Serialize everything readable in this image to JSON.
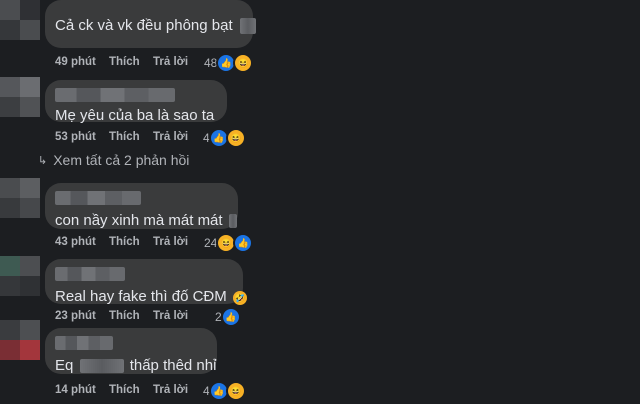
{
  "comments": [
    {
      "text": "Cả ck và vk đều phông bạt",
      "time": "49 phút",
      "like": "Thích",
      "reply": "Trả lời",
      "reaction_count": "48"
    },
    {
      "text": "Mẹ yêu của ba là sao ta",
      "time": "53 phút",
      "like": "Thích",
      "reply": "Trả lời",
      "reaction_count": "4"
    },
    {
      "text": "con nầy xinh mà mát mát",
      "time": "43 phút",
      "like": "Thích",
      "reply": "Trả lời",
      "reaction_count": "24"
    },
    {
      "text": "Real hay fake thì đố CĐM",
      "time": "23 phút",
      "like": "Thích",
      "reply": "Trả lời",
      "reaction_count": "2"
    },
    {
      "text_prefix": "Eq",
      "text_suffix": "thấp thêd nhỉ",
      "time": "14 phút",
      "like": "Thích",
      "reply": "Trả lời",
      "reaction_count": "4"
    }
  ],
  "view_replies": "Xem tất cả 2 phản hồi",
  "icons": {
    "like": "like-icon",
    "haha": "haha-icon",
    "reply_arrow": "reply-arrow-icon"
  },
  "colors": {
    "background": "#1c1e21",
    "bubble": "#3a3b3c",
    "like_blue": "#1b74e4",
    "haha_yellow": "#f7b125"
  }
}
